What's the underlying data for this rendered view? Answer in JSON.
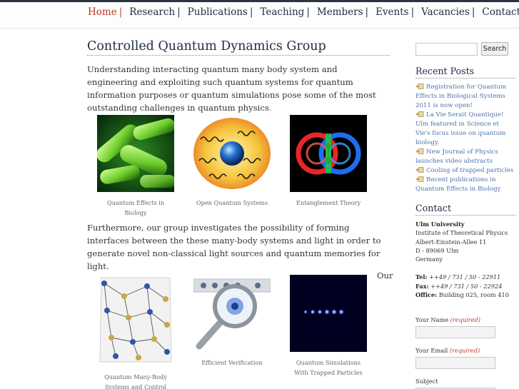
{
  "nav": {
    "items": [
      {
        "label": "Home",
        "sep": "|",
        "active": true
      },
      {
        "label": "Research",
        "sep": "|",
        "active": false
      },
      {
        "label": "Publications",
        "sep": "|",
        "active": false
      },
      {
        "label": "Teaching",
        "sep": "|",
        "active": false
      },
      {
        "label": "Members",
        "sep": "|",
        "active": false
      },
      {
        "label": "Events",
        "sep": "|",
        "active": false
      },
      {
        "label": "Vacancies",
        "sep": "|",
        "active": false
      },
      {
        "label": "Contact",
        "sep": "",
        "active": false
      }
    ]
  },
  "main": {
    "title": "Controlled Quantum Dynamics Group",
    "intro": "Understanding interacting quantum many body system and engineering and exploiting such quantum systems for quantum information purposes or quantum simulations pose some of the most outstanding challenges in quantum physics.",
    "figures_row1": [
      {
        "caption": "Quantum Effects in Biology",
        "icon": "bacteria-image"
      },
      {
        "caption": "Open Quantum Systems",
        "icon": "open-system-image"
      },
      {
        "caption": "Entanglement Theory",
        "icon": "entanglement-image"
      }
    ],
    "para2": "Furthermore, our group investigates the possibility of forming interfaces between the these many-body systems and light in order to generate novel non-classical light sources and quantum memories for light.",
    "figures_row2": [
      {
        "caption": "Quantum Many-Body Systems and Control",
        "icon": "lattice-image"
      },
      {
        "caption": "Efficient Verification",
        "icon": "magnifier-image"
      },
      {
        "caption": "Quantum Simulations With Trapped Particles",
        "icon": "trapped-ions-image"
      }
    ],
    "trailing_word": "Our"
  },
  "sidebar": {
    "search_placeholder": "",
    "search_button": "Search",
    "recent_posts_heading": "Recent Posts",
    "posts": [
      "Registration for Quantum Effects in Biological Systems 2011 is now open!",
      "La Vie Serait Quantique! Ulm featured in Science et Vie's focus issue on quantum biology.",
      "New Journal of Physics launches video abstracts",
      "Cooling of trapped particles",
      "Recent publications in Quantum Effects in Biology"
    ],
    "contact_heading": "Contact",
    "contact": {
      "org": "Ulm University",
      "line1": "Institute of Theoretical Physics",
      "line2": "Albert-Einstein-Allee 11",
      "line3": "D - 89069 Ulm",
      "line4": "Germany",
      "tel_label": "Tel:",
      "tel": "++49 / 731 / 50 - 22911",
      "fax_label": "Fax:",
      "fax": "++49 / 731 / 50 - 22924",
      "office_label": "Office:",
      "office": "Building 025, room 410"
    },
    "form": {
      "name_label": "Your Name",
      "email_label": "Your Email",
      "required": "(required)",
      "subject_label": "Subject"
    }
  },
  "colors": {
    "nav_active": "#c0392b",
    "heading": "#1f2a44",
    "link": "#4a74a8"
  }
}
